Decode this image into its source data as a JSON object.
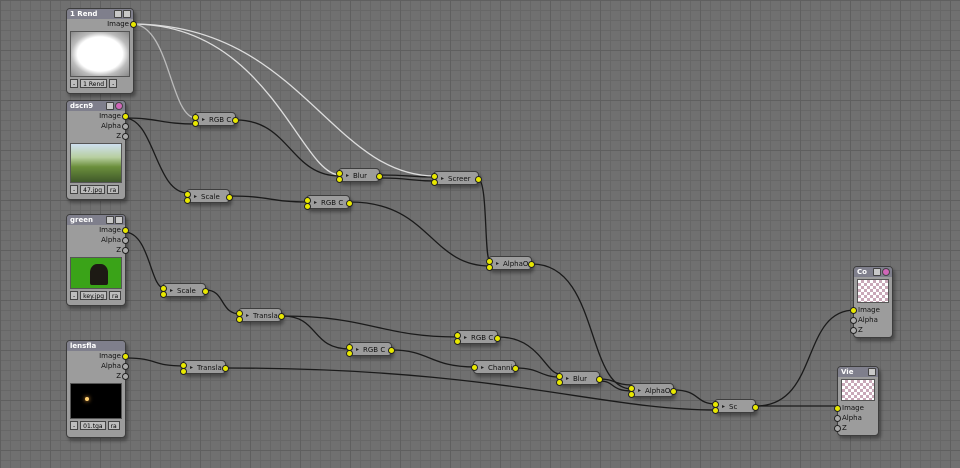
{
  "colors": {
    "grid_bg": "#707070",
    "node_body": "#9c9c9c",
    "header": "#7f7f8c",
    "socket_image": "#e8e800",
    "socket_value": "#aaaaaa",
    "wire": "#1a1a1a",
    "wire_selected": "#dddddd"
  },
  "input_nodes": {
    "render": {
      "title": "1 Rend",
      "out_image": "Image",
      "footer_label": "1 Rend"
    },
    "dscn": {
      "title": "dscn9",
      "out_image": "Image",
      "out_alpha": "Alpha",
      "out_z": "Z",
      "footer_label": "47.jpg",
      "footer_extra": "ra"
    },
    "green": {
      "title": "green",
      "out_image": "Image",
      "out_alpha": "Alpha",
      "out_z": "Z",
      "footer_label": "key.jpg",
      "footer_extra": "ra"
    },
    "lensfla": {
      "title": "lensfla",
      "out_image": "Image",
      "out_alpha": "Alpha",
      "out_z": "Z",
      "footer_label": "01.tga",
      "footer_extra": "ra"
    }
  },
  "op_nodes": {
    "rgbc_1": "RGB C",
    "blur_1": "Blur",
    "screen": "Screer",
    "scale_1": "Scale",
    "rgbc_2": "RGB C",
    "alphaover_1": "AlphaO",
    "scale_2": "Scale",
    "translate_1": "Transla",
    "rgbc_3": "RGB C",
    "rgbc_4": "RGB C",
    "channel": "Channi",
    "translate_2": "Transla",
    "blur_2": "Blur",
    "alphaover_2": "AlphaO",
    "screen_2": "Sc"
  },
  "output_nodes": {
    "composite": {
      "title": "Co",
      "in_image": "Image",
      "in_alpha": "Alpha",
      "in_z": "Z"
    },
    "viewer": {
      "title": "Vie",
      "in_image": "Image",
      "in_alpha": "Alpha",
      "in_z": "Z"
    }
  }
}
